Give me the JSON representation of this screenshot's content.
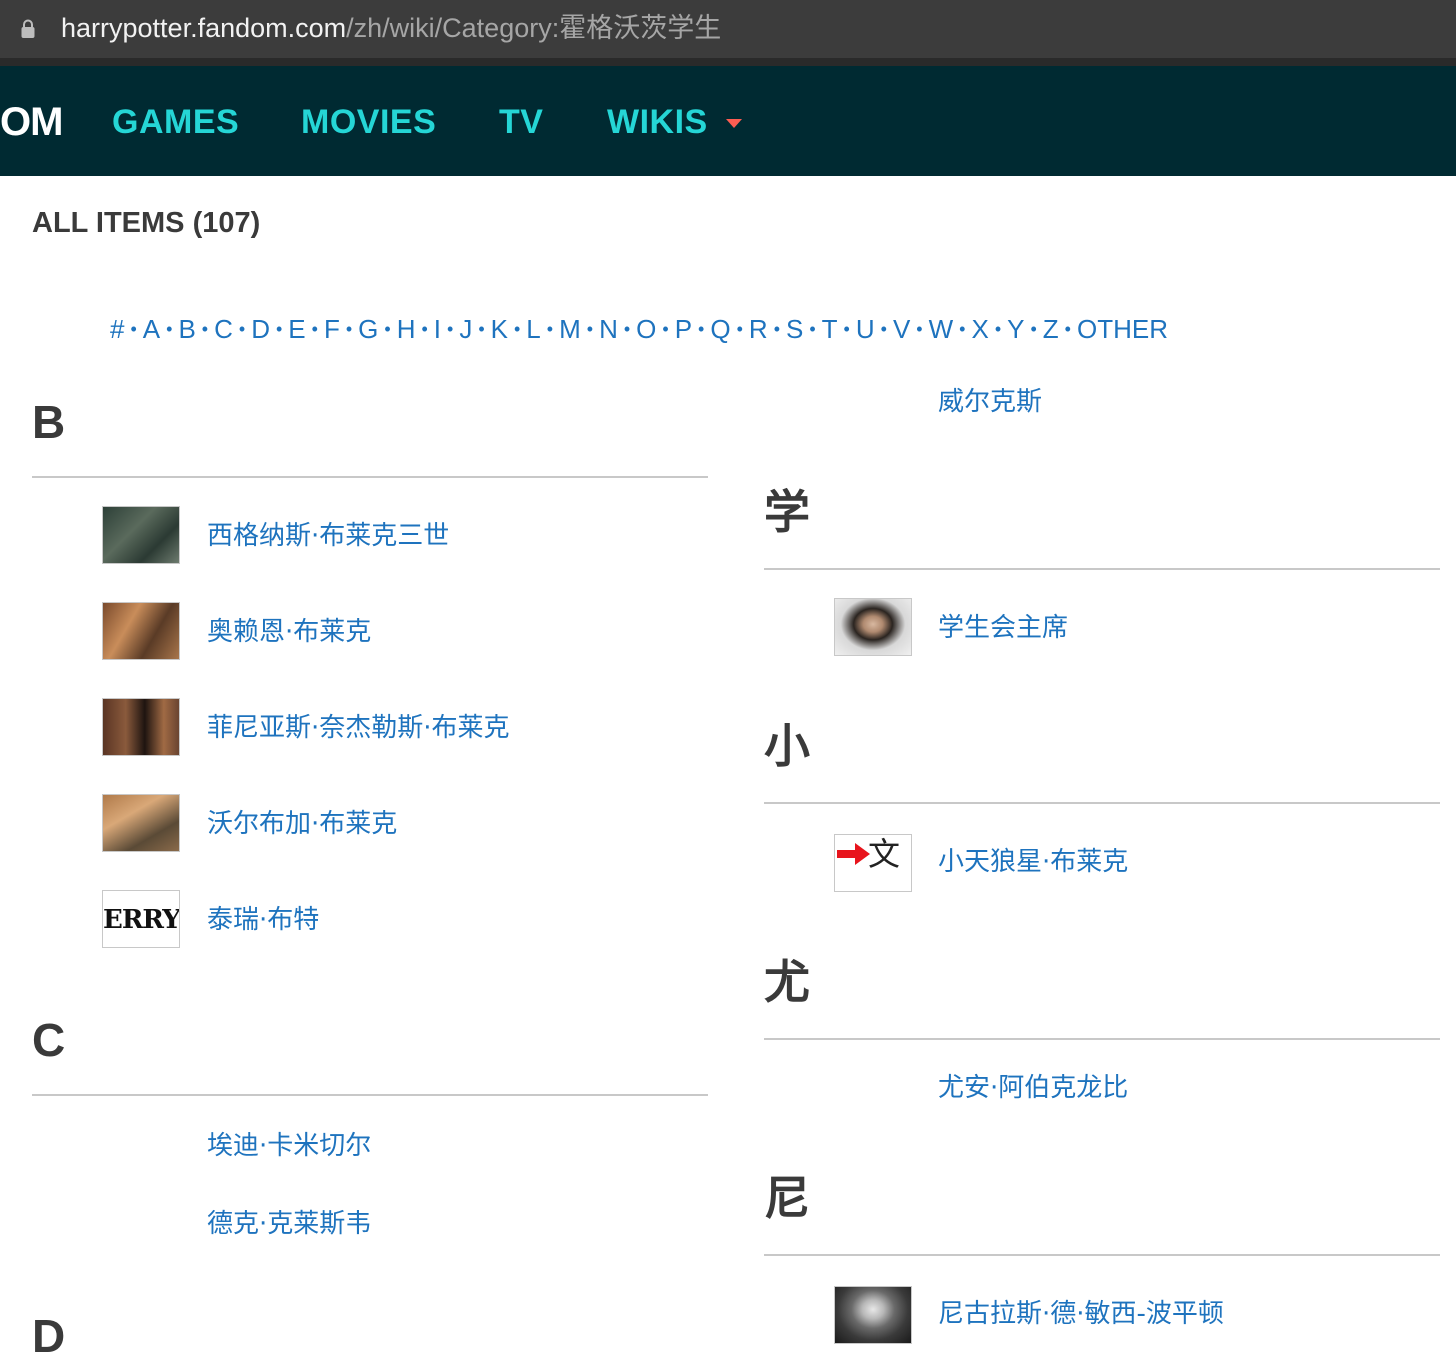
{
  "browser": {
    "url_host": "harrypotter.fandom.com",
    "url_path": "/zh/wiki/Category:霍格沃茨学生"
  },
  "nav": {
    "logo_fragment": "OM",
    "items": [
      "GAMES",
      "MOVIES",
      "TV",
      "WIKIS"
    ],
    "accent_color": "#25d6d6",
    "caret_color": "#fd5d52"
  },
  "category": {
    "all_items": "ALL ITEMS (107)",
    "alphabet": [
      "#",
      "A",
      "B",
      "C",
      "D",
      "E",
      "F",
      "G",
      "H",
      "I",
      "J",
      "K",
      "L",
      "M",
      "N",
      "O",
      "P",
      "Q",
      "R",
      "S",
      "T",
      "U",
      "V",
      "W",
      "X",
      "Y",
      "Z",
      "OTHER"
    ],
    "left_sections": [
      {
        "letter": "B",
        "entries": [
          "西格纳斯·布莱克三世",
          "奥赖恩·布莱克",
          "菲尼亚斯·奈杰勒斯·布莱克",
          "沃尔布加·布莱克",
          "泰瑞·布特"
        ]
      },
      {
        "letter": "C",
        "entries": [
          "埃迪·卡米切尔",
          "德克·克莱斯韦"
        ]
      },
      {
        "letter": "D",
        "entries": []
      }
    ],
    "right_top_entry": "威尔克斯",
    "right_sections": [
      {
        "letter": "学",
        "entries": [
          "学生会主席"
        ]
      },
      {
        "letter": "小",
        "entries": [
          "小天狼星·布莱克"
        ]
      },
      {
        "letter": "尤",
        "entries": [
          "尤安·阿伯克龙比"
        ]
      },
      {
        "letter": "尼",
        "entries": [
          "尼古拉斯·德·敏西-波平顿"
        ]
      }
    ],
    "thumb_text": "ERRY T",
    "translate_glyph": "文"
  }
}
